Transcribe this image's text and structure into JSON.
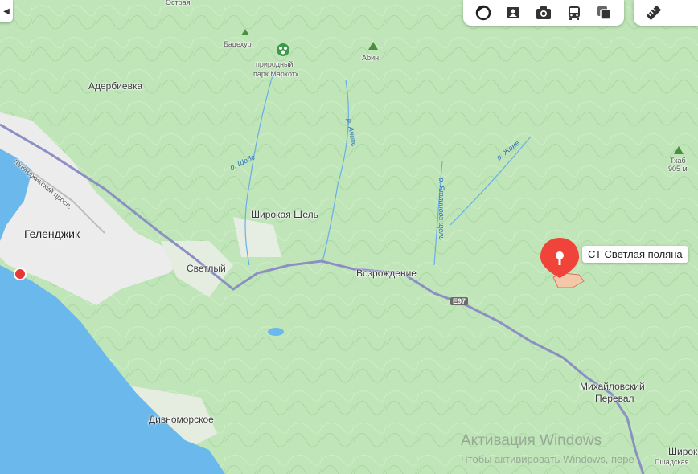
{
  "map": {
    "colors": {
      "sea": "#6ab8ec",
      "land": "#bfe5b8",
      "urban": "#ececec",
      "road": "#8b8fc4",
      "marker": "#e53935"
    },
    "places": {
      "ostraya": "Острая",
      "adderbievka": "Адербиевка",
      "batsekhur": "Бацехур",
      "park_line1": "природный",
      "park_line2": "парк Маркотх",
      "abin": "Абин",
      "gelendzhik": "Геленджик",
      "shirokaya_shchel": "Широкая Щель",
      "svetly": "Светлый",
      "vozrozhdenie": "Возрождение",
      "divnomorskoe": "Дивноморское",
      "mikhaylovsky_line1": "Михайловский",
      "mikhaylovsky_line2": "Перевал",
      "shirok_partial": "Широк",
      "pshadskaya_partial": "Пшадская",
      "tkhab": "Тхаб",
      "tkhab_height": "905 м"
    },
    "rivers": {
      "shebs": "р. Шебс",
      "achips": "р. Ачипс",
      "yapliknova": "р. Ятлинова щель",
      "zhane": "р. Жане"
    },
    "roads": {
      "gelendzhik_prospekt": "геленджикский просп.",
      "e97": "E97"
    },
    "marker_label": "СТ Светлая поляна"
  },
  "toolbar": {
    "icons": [
      "layers-icon",
      "panorama-icon",
      "photo-icon",
      "transport-icon",
      "map-layers-icon"
    ],
    "ruler_icon": "ruler-icon",
    "collapse_icon": "collapse-icon"
  },
  "watermark": {
    "title": "Активация Windows",
    "subtitle": "Чтобы активировать Windows, пере"
  }
}
